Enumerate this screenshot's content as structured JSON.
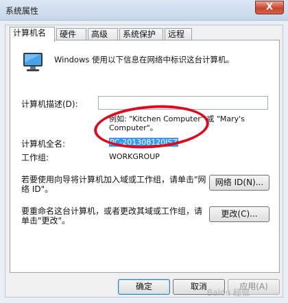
{
  "window": {
    "title": "系统属性",
    "close_glyph": "X"
  },
  "tabs": [
    {
      "label": "计算机名",
      "active": true
    },
    {
      "label": "硬件",
      "active": false
    },
    {
      "label": "高级",
      "active": false
    },
    {
      "label": "系统保护",
      "active": false
    },
    {
      "label": "远程",
      "active": false
    }
  ],
  "computer_name": {
    "intro": "Windows 使用以下信息在网络中标识这台计算机。",
    "description_label": "计算机描述(D):",
    "description_value": "",
    "example": "例如: \"Kitchen Computer\" 或 \"Mary's Computer\"。",
    "full_name_label": "计算机全名:",
    "full_name_value": "PC-201308120JSZ",
    "workgroup_label": "工作组:",
    "workgroup_value": "WORKGROUP",
    "join_text": "若要使用向导将计算机加入域或工作组，请单击\"网络 ID\"。",
    "network_id_button": "网络 ID(N)...",
    "rename_text": "要重命名这台计算机，或者更改其域或工作组，请单击\"更改\"。",
    "change_button": "更改(C)..."
  },
  "footer": {
    "ok_button": "确定",
    "cancel_button": "取消",
    "apply_button": "应用(A)"
  },
  "watermark": "Baidu 经验",
  "colors": {
    "annotation_ring": "#e0081c",
    "selection": "#3399ff",
    "title_bar": "#c6d6ea"
  }
}
